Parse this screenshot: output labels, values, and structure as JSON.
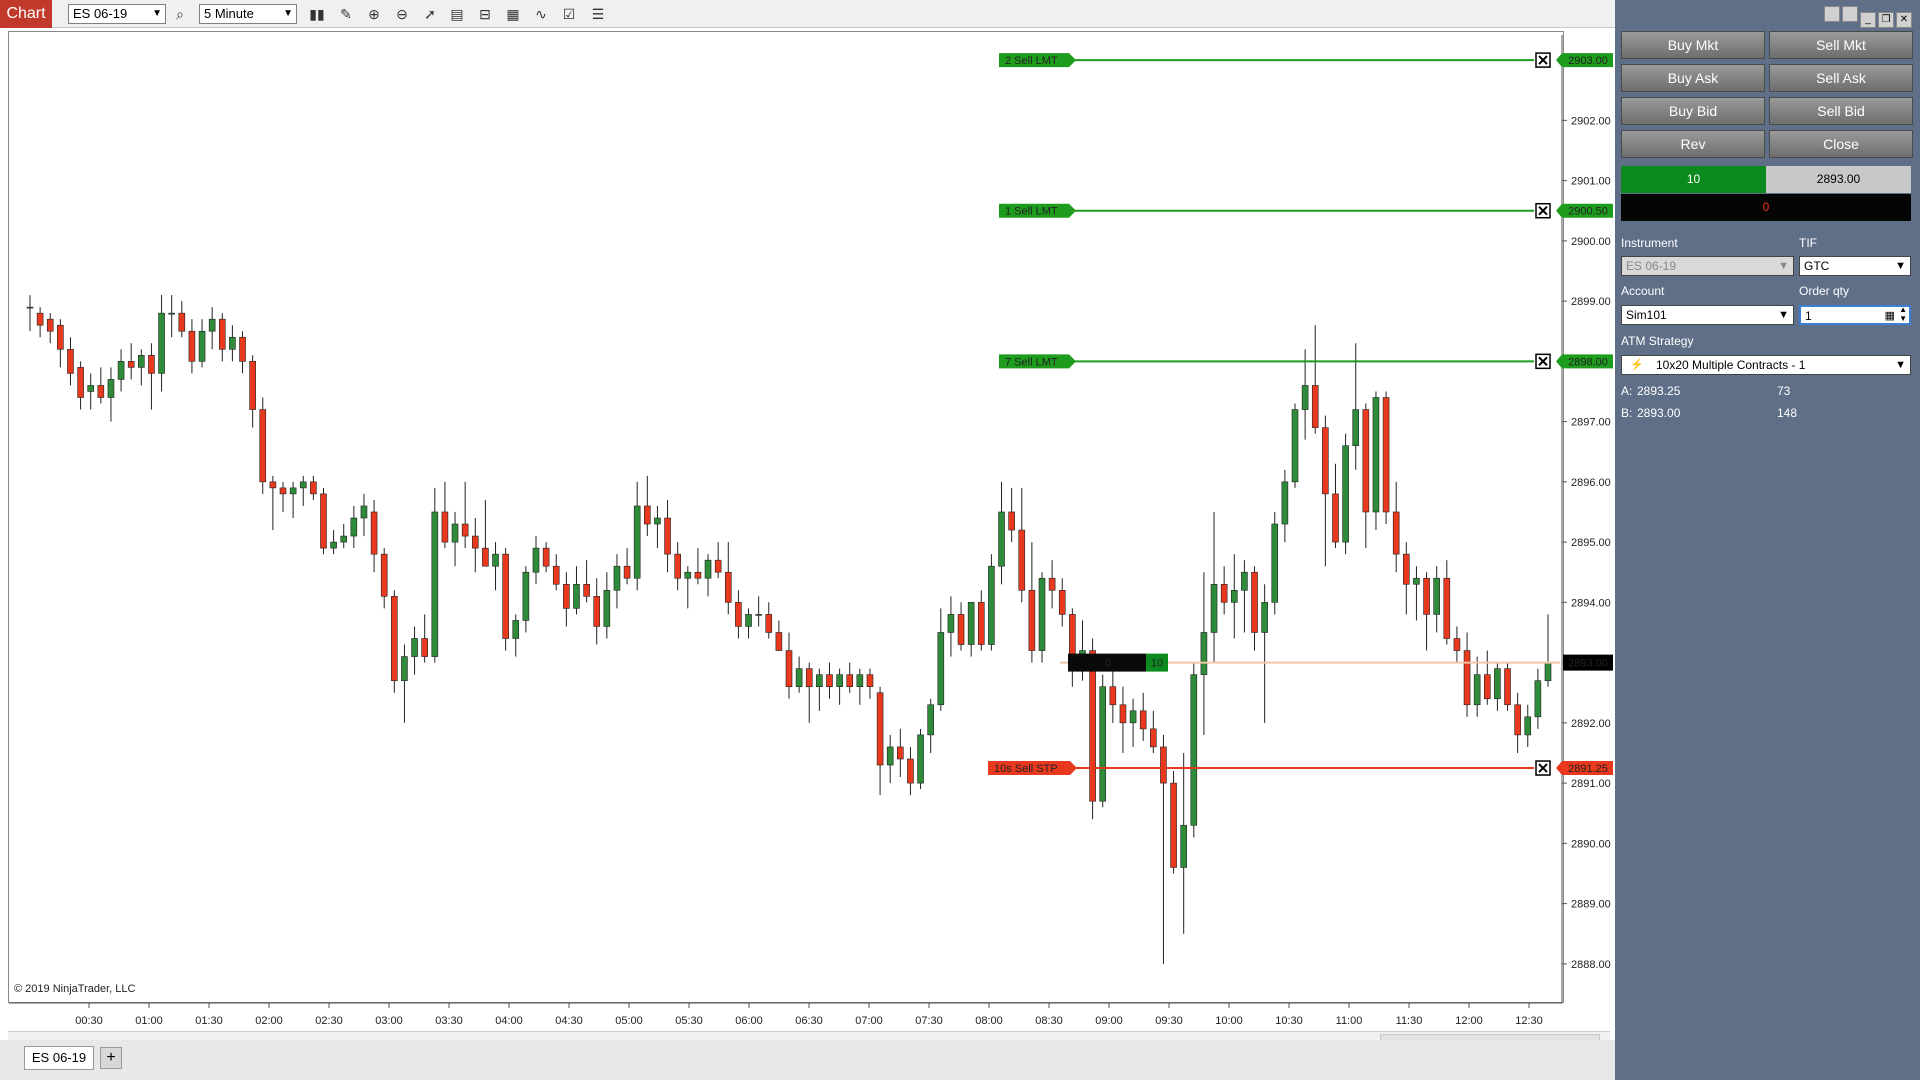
{
  "toolbar": {
    "app_tab": "Chart",
    "instrument": "ES 06-19",
    "interval": "5 Minute"
  },
  "chart": {
    "copyright": "© 2019 NinjaTrader, LLC",
    "price_axis": [
      "2903.00",
      "2902.00",
      "2901.00",
      "2900.00",
      "2899.00",
      "2898.00",
      "2897.00",
      "2896.00",
      "2895.00",
      "2894.00",
      "2893.00",
      "2892.00",
      "2891.00",
      "2890.00",
      "2889.00",
      "2888.00"
    ],
    "time_axis": [
      "00:30",
      "01:00",
      "01:30",
      "02:00",
      "02:30",
      "03:00",
      "03:30",
      "04:00",
      "04:30",
      "05:00",
      "05:30",
      "06:00",
      "06:30",
      "07:00",
      "07:30",
      "08:00",
      "08:30",
      "09:00",
      "09:30",
      "10:00",
      "10:30",
      "11:00",
      "11:30",
      "12:00",
      "12:30"
    ],
    "price_range": [
      2887.4,
      2903.4
    ],
    "last_price": "2893.00",
    "orders": [
      {
        "label": "2  Sell LMT",
        "price": 2903.0,
        "price_text": "2903.00",
        "color": "#1e9c1e"
      },
      {
        "label": "1  Sell LMT",
        "price": 2900.5,
        "price_text": "2900.50",
        "color": "#1e9c1e"
      },
      {
        "label": "7  Sell LMT",
        "price": 2898.0,
        "price_text": "2898.00",
        "color": "#1e9c1e"
      },
      {
        "label": "10s  Sell STP",
        "price": 2891.25,
        "price_text": "2891.25",
        "color": "#e8381e"
      }
    ],
    "position_badge": {
      "pnl": "0",
      "qty": "10"
    },
    "candles": [
      {
        "o": 2898.9,
        "h": 2899.1,
        "l": 2898.5,
        "c": 2898.9
      },
      {
        "o": 2898.8,
        "h": 2898.9,
        "l": 2898.4,
        "c": 2898.6
      },
      {
        "o": 2898.7,
        "h": 2898.8,
        "l": 2898.3,
        "c": 2898.5
      },
      {
        "o": 2898.6,
        "h": 2898.7,
        "l": 2897.9,
        "c": 2898.2
      },
      {
        "o": 2898.2,
        "h": 2898.4,
        "l": 2897.6,
        "c": 2897.8
      },
      {
        "o": 2897.9,
        "h": 2898.0,
        "l": 2897.2,
        "c": 2897.4
      },
      {
        "o": 2897.5,
        "h": 2897.8,
        "l": 2897.2,
        "c": 2897.6
      },
      {
        "o": 2897.6,
        "h": 2897.9,
        "l": 2897.3,
        "c": 2897.4
      },
      {
        "o": 2897.4,
        "h": 2897.9,
        "l": 2897.0,
        "c": 2897.7
      },
      {
        "o": 2897.7,
        "h": 2898.2,
        "l": 2897.5,
        "c": 2898.0
      },
      {
        "o": 2898.0,
        "h": 2898.3,
        "l": 2897.7,
        "c": 2897.9
      },
      {
        "o": 2897.9,
        "h": 2898.2,
        "l": 2897.6,
        "c": 2898.1
      },
      {
        "o": 2898.1,
        "h": 2898.3,
        "l": 2897.2,
        "c": 2897.8
      },
      {
        "o": 2897.8,
        "h": 2899.1,
        "l": 2897.5,
        "c": 2898.8
      },
      {
        "o": 2898.8,
        "h": 2899.1,
        "l": 2898.4,
        "c": 2898.8
      },
      {
        "o": 2898.8,
        "h": 2899.0,
        "l": 2898.4,
        "c": 2898.5
      },
      {
        "o": 2898.5,
        "h": 2898.7,
        "l": 2897.8,
        "c": 2898.0
      },
      {
        "o": 2898.0,
        "h": 2898.7,
        "l": 2897.9,
        "c": 2898.5
      },
      {
        "o": 2898.5,
        "h": 2898.9,
        "l": 2898.2,
        "c": 2898.7
      },
      {
        "o": 2898.7,
        "h": 2898.8,
        "l": 2898.0,
        "c": 2898.2
      },
      {
        "o": 2898.2,
        "h": 2898.6,
        "l": 2898.0,
        "c": 2898.4
      },
      {
        "o": 2898.4,
        "h": 2898.5,
        "l": 2897.8,
        "c": 2898.0
      },
      {
        "o": 2898.0,
        "h": 2898.1,
        "l": 2896.9,
        "c": 2897.2
      },
      {
        "o": 2897.2,
        "h": 2897.4,
        "l": 2895.8,
        "c": 2896.0
      },
      {
        "o": 2896.0,
        "h": 2896.1,
        "l": 2895.2,
        "c": 2895.9
      },
      {
        "o": 2895.9,
        "h": 2896.0,
        "l": 2895.5,
        "c": 2895.8
      },
      {
        "o": 2895.8,
        "h": 2896.0,
        "l": 2895.4,
        "c": 2895.9
      },
      {
        "o": 2895.9,
        "h": 2896.1,
        "l": 2895.6,
        "c": 2896.0
      },
      {
        "o": 2896.0,
        "h": 2896.1,
        "l": 2895.7,
        "c": 2895.8
      },
      {
        "o": 2895.8,
        "h": 2895.9,
        "l": 2894.8,
        "c": 2894.9
      },
      {
        "o": 2894.9,
        "h": 2895.2,
        "l": 2894.8,
        "c": 2895.0
      },
      {
        "o": 2895.0,
        "h": 2895.3,
        "l": 2894.9,
        "c": 2895.1
      },
      {
        "o": 2895.1,
        "h": 2895.6,
        "l": 2894.9,
        "c": 2895.4
      },
      {
        "o": 2895.4,
        "h": 2895.8,
        "l": 2895.1,
        "c": 2895.6
      },
      {
        "o": 2895.5,
        "h": 2895.7,
        "l": 2894.5,
        "c": 2894.8
      },
      {
        "o": 2894.8,
        "h": 2894.9,
        "l": 2893.9,
        "c": 2894.1
      },
      {
        "o": 2894.1,
        "h": 2894.2,
        "l": 2892.5,
        "c": 2892.7
      },
      {
        "o": 2892.7,
        "h": 2893.3,
        "l": 2892.0,
        "c": 2893.1
      },
      {
        "o": 2893.1,
        "h": 2893.6,
        "l": 2892.8,
        "c": 2893.4
      },
      {
        "o": 2893.4,
        "h": 2893.8,
        "l": 2893.0,
        "c": 2893.1
      },
      {
        "o": 2893.1,
        "h": 2895.9,
        "l": 2893.0,
        "c": 2895.5
      },
      {
        "o": 2895.5,
        "h": 2896.0,
        "l": 2894.9,
        "c": 2895.0
      },
      {
        "o": 2895.0,
        "h": 2895.5,
        "l": 2894.6,
        "c": 2895.3
      },
      {
        "o": 2895.3,
        "h": 2896.0,
        "l": 2894.9,
        "c": 2895.1
      },
      {
        "o": 2895.1,
        "h": 2895.4,
        "l": 2894.5,
        "c": 2894.9
      },
      {
        "o": 2894.9,
        "h": 2895.7,
        "l": 2894.7,
        "c": 2894.6
      },
      {
        "o": 2894.6,
        "h": 2895.0,
        "l": 2894.2,
        "c": 2894.8
      },
      {
        "o": 2894.8,
        "h": 2894.9,
        "l": 2893.2,
        "c": 2893.4
      },
      {
        "o": 2893.4,
        "h": 2893.8,
        "l": 2893.1,
        "c": 2893.7
      },
      {
        "o": 2893.7,
        "h": 2894.6,
        "l": 2893.5,
        "c": 2894.5
      },
      {
        "o": 2894.5,
        "h": 2895.1,
        "l": 2894.3,
        "c": 2894.9
      },
      {
        "o": 2894.9,
        "h": 2895.0,
        "l": 2894.5,
        "c": 2894.6
      },
      {
        "o": 2894.6,
        "h": 2894.8,
        "l": 2894.2,
        "c": 2894.3
      },
      {
        "o": 2894.3,
        "h": 2894.5,
        "l": 2893.6,
        "c": 2893.9
      },
      {
        "o": 2893.9,
        "h": 2894.6,
        "l": 2893.8,
        "c": 2894.3
      },
      {
        "o": 2894.3,
        "h": 2894.7,
        "l": 2894.0,
        "c": 2894.1
      },
      {
        "o": 2894.1,
        "h": 2894.4,
        "l": 2893.3,
        "c": 2893.6
      },
      {
        "o": 2893.6,
        "h": 2894.5,
        "l": 2893.4,
        "c": 2894.2
      },
      {
        "o": 2894.2,
        "h": 2894.8,
        "l": 2893.9,
        "c": 2894.6
      },
      {
        "o": 2894.6,
        "h": 2894.9,
        "l": 2894.3,
        "c": 2894.4
      },
      {
        "o": 2894.4,
        "h": 2896.0,
        "l": 2894.2,
        "c": 2895.6
      },
      {
        "o": 2895.6,
        "h": 2896.1,
        "l": 2895.1,
        "c": 2895.3
      },
      {
        "o": 2895.3,
        "h": 2895.6,
        "l": 2894.9,
        "c": 2895.4
      },
      {
        "o": 2895.4,
        "h": 2895.7,
        "l": 2894.5,
        "c": 2894.8
      },
      {
        "o": 2894.8,
        "h": 2895.0,
        "l": 2894.2,
        "c": 2894.4
      },
      {
        "o": 2894.4,
        "h": 2894.6,
        "l": 2893.9,
        "c": 2894.5
      },
      {
        "o": 2894.5,
        "h": 2894.9,
        "l": 2894.3,
        "c": 2894.4
      },
      {
        "o": 2894.4,
        "h": 2894.8,
        "l": 2894.1,
        "c": 2894.7
      },
      {
        "o": 2894.7,
        "h": 2895.0,
        "l": 2894.4,
        "c": 2894.5
      },
      {
        "o": 2894.5,
        "h": 2895.0,
        "l": 2893.8,
        "c": 2894.0
      },
      {
        "o": 2894.0,
        "h": 2894.2,
        "l": 2893.4,
        "c": 2893.6
      },
      {
        "o": 2893.6,
        "h": 2893.9,
        "l": 2893.4,
        "c": 2893.8
      },
      {
        "o": 2893.8,
        "h": 2894.1,
        "l": 2893.6,
        "c": 2893.8
      },
      {
        "o": 2893.8,
        "h": 2894.0,
        "l": 2893.4,
        "c": 2893.5
      },
      {
        "o": 2893.5,
        "h": 2893.7,
        "l": 2893.3,
        "c": 2893.2
      },
      {
        "o": 2893.2,
        "h": 2893.5,
        "l": 2892.4,
        "c": 2892.6
      },
      {
        "o": 2892.6,
        "h": 2893.1,
        "l": 2892.5,
        "c": 2892.9
      },
      {
        "o": 2892.9,
        "h": 2893.0,
        "l": 2892.0,
        "c": 2892.6
      },
      {
        "o": 2892.6,
        "h": 2892.9,
        "l": 2892.2,
        "c": 2892.8
      },
      {
        "o": 2892.8,
        "h": 2893.0,
        "l": 2892.4,
        "c": 2892.6
      },
      {
        "o": 2892.6,
        "h": 2892.9,
        "l": 2892.3,
        "c": 2892.8
      },
      {
        "o": 2892.8,
        "h": 2893.0,
        "l": 2892.5,
        "c": 2892.6
      },
      {
        "o": 2892.6,
        "h": 2892.9,
        "l": 2892.3,
        "c": 2892.8
      },
      {
        "o": 2892.8,
        "h": 2892.9,
        "l": 2892.4,
        "c": 2892.6
      },
      {
        "o": 2892.5,
        "h": 2892.6,
        "l": 2890.8,
        "c": 2891.3
      },
      {
        "o": 2891.3,
        "h": 2891.8,
        "l": 2891.0,
        "c": 2891.6
      },
      {
        "o": 2891.6,
        "h": 2891.9,
        "l": 2891.1,
        "c": 2891.4
      },
      {
        "o": 2891.4,
        "h": 2891.6,
        "l": 2890.8,
        "c": 2891.0
      },
      {
        "o": 2891.0,
        "h": 2891.9,
        "l": 2890.9,
        "c": 2891.8
      },
      {
        "o": 2891.8,
        "h": 2892.4,
        "l": 2891.5,
        "c": 2892.3
      },
      {
        "o": 2892.3,
        "h": 2893.9,
        "l": 2892.2,
        "c": 2893.5
      },
      {
        "o": 2893.5,
        "h": 2894.1,
        "l": 2893.1,
        "c": 2893.8
      },
      {
        "o": 2893.8,
        "h": 2894.0,
        "l": 2893.2,
        "c": 2893.3
      },
      {
        "o": 2893.3,
        "h": 2894.0,
        "l": 2893.1,
        "c": 2894.0
      },
      {
        "o": 2894.0,
        "h": 2894.2,
        "l": 2893.2,
        "c": 2893.3
      },
      {
        "o": 2893.3,
        "h": 2894.8,
        "l": 2893.2,
        "c": 2894.6
      },
      {
        "o": 2894.6,
        "h": 2896.0,
        "l": 2894.3,
        "c": 2895.5
      },
      {
        "o": 2895.5,
        "h": 2895.9,
        "l": 2895.0,
        "c": 2895.2
      },
      {
        "o": 2895.2,
        "h": 2895.9,
        "l": 2894.0,
        "c": 2894.2
      },
      {
        "o": 2894.2,
        "h": 2895.0,
        "l": 2893.0,
        "c": 2893.2
      },
      {
        "o": 2893.2,
        "h": 2894.5,
        "l": 2893.0,
        "c": 2894.4
      },
      {
        "o": 2894.4,
        "h": 2894.7,
        "l": 2893.9,
        "c": 2894.2
      },
      {
        "o": 2894.2,
        "h": 2894.4,
        "l": 2893.6,
        "c": 2893.8
      },
      {
        "o": 2893.8,
        "h": 2893.9,
        "l": 2892.6,
        "c": 2892.9
      },
      {
        "o": 2892.9,
        "h": 2893.7,
        "l": 2892.7,
        "c": 2893.2
      },
      {
        "o": 2893.2,
        "h": 2893.4,
        "l": 2890.4,
        "c": 2890.7
      },
      {
        "o": 2890.7,
        "h": 2892.8,
        "l": 2890.6,
        "c": 2892.6
      },
      {
        "o": 2892.6,
        "h": 2893.0,
        "l": 2892.0,
        "c": 2892.3
      },
      {
        "o": 2892.3,
        "h": 2892.6,
        "l": 2891.5,
        "c": 2892.0
      },
      {
        "o": 2892.0,
        "h": 2892.4,
        "l": 2891.6,
        "c": 2892.2
      },
      {
        "o": 2892.2,
        "h": 2892.5,
        "l": 2891.7,
        "c": 2891.9
      },
      {
        "o": 2891.9,
        "h": 2892.2,
        "l": 2891.5,
        "c": 2891.6
      },
      {
        "o": 2891.6,
        "h": 2891.8,
        "l": 2888.0,
        "c": 2891.0
      },
      {
        "o": 2891.0,
        "h": 2891.2,
        "l": 2889.5,
        "c": 2889.6
      },
      {
        "o": 2889.6,
        "h": 2891.5,
        "l": 2888.5,
        "c": 2890.3
      },
      {
        "o": 2890.3,
        "h": 2893.0,
        "l": 2890.1,
        "c": 2892.8
      },
      {
        "o": 2892.8,
        "h": 2894.5,
        "l": 2891.8,
        "c": 2893.5
      },
      {
        "o": 2893.5,
        "h": 2895.5,
        "l": 2893.0,
        "c": 2894.3
      },
      {
        "o": 2894.3,
        "h": 2894.6,
        "l": 2893.8,
        "c": 2894.0
      },
      {
        "o": 2894.0,
        "h": 2894.8,
        "l": 2893.4,
        "c": 2894.2
      },
      {
        "o": 2894.2,
        "h": 2894.7,
        "l": 2893.5,
        "c": 2894.5
      },
      {
        "o": 2894.5,
        "h": 2894.6,
        "l": 2893.2,
        "c": 2893.5
      },
      {
        "o": 2893.5,
        "h": 2894.3,
        "l": 2892.0,
        "c": 2894.0
      },
      {
        "o": 2894.0,
        "h": 2895.5,
        "l": 2893.8,
        "c": 2895.3
      },
      {
        "o": 2895.3,
        "h": 2896.2,
        "l": 2895.0,
        "c": 2896.0
      },
      {
        "o": 2896.0,
        "h": 2897.3,
        "l": 2895.9,
        "c": 2897.2
      },
      {
        "o": 2897.2,
        "h": 2898.2,
        "l": 2896.7,
        "c": 2897.6
      },
      {
        "o": 2897.6,
        "h": 2898.6,
        "l": 2896.8,
        "c": 2896.9
      },
      {
        "o": 2896.9,
        "h": 2897.1,
        "l": 2894.6,
        "c": 2895.8
      },
      {
        "o": 2895.8,
        "h": 2896.3,
        "l": 2894.9,
        "c": 2895.0
      },
      {
        "o": 2895.0,
        "h": 2896.8,
        "l": 2894.8,
        "c": 2896.6
      },
      {
        "o": 2896.6,
        "h": 2898.3,
        "l": 2896.2,
        "c": 2897.2
      },
      {
        "o": 2897.2,
        "h": 2897.3,
        "l": 2894.9,
        "c": 2895.5
      },
      {
        "o": 2895.5,
        "h": 2897.5,
        "l": 2895.2,
        "c": 2897.4
      },
      {
        "o": 2897.4,
        "h": 2897.5,
        "l": 2895.3,
        "c": 2895.5
      },
      {
        "o": 2895.5,
        "h": 2896.0,
        "l": 2894.5,
        "c": 2894.8
      },
      {
        "o": 2894.8,
        "h": 2895.0,
        "l": 2893.8,
        "c": 2894.3
      },
      {
        "o": 2894.3,
        "h": 2894.6,
        "l": 2893.7,
        "c": 2894.4
      },
      {
        "o": 2894.4,
        "h": 2894.5,
        "l": 2893.2,
        "c": 2893.8
      },
      {
        "o": 2893.8,
        "h": 2894.6,
        "l": 2893.5,
        "c": 2894.4
      },
      {
        "o": 2894.4,
        "h": 2894.7,
        "l": 2893.3,
        "c": 2893.4
      },
      {
        "o": 2893.4,
        "h": 2893.6,
        "l": 2893.0,
        "c": 2893.2
      },
      {
        "o": 2893.2,
        "h": 2893.5,
        "l": 2892.1,
        "c": 2892.3
      },
      {
        "o": 2892.3,
        "h": 2893.1,
        "l": 2892.1,
        "c": 2892.8
      },
      {
        "o": 2892.8,
        "h": 2893.2,
        "l": 2892.3,
        "c": 2892.4
      },
      {
        "o": 2892.4,
        "h": 2893.0,
        "l": 2892.2,
        "c": 2892.9
      },
      {
        "o": 2892.9,
        "h": 2893.0,
        "l": 2892.2,
        "c": 2892.3
      },
      {
        "o": 2892.3,
        "h": 2892.5,
        "l": 2891.5,
        "c": 2891.8
      },
      {
        "o": 2891.8,
        "h": 2892.3,
        "l": 2891.6,
        "c": 2892.1
      },
      {
        "o": 2892.1,
        "h": 2892.9,
        "l": 2891.9,
        "c": 2892.7
      },
      {
        "o": 2892.7,
        "h": 2893.8,
        "l": 2892.6,
        "c": 2893.0
      }
    ]
  },
  "panel": {
    "buttons": {
      "buy_mkt": "Buy Mkt",
      "sell_mkt": "Sell Mkt",
      "buy_ask": "Buy Ask",
      "sell_ask": "Sell Ask",
      "buy_bid": "Buy Bid",
      "sell_bid": "Sell Bid",
      "rev": "Rev",
      "close": "Close"
    },
    "position_qty": "10",
    "position_price": "2893.00",
    "unrealized_pnl": "0",
    "instrument_label": "Instrument",
    "instrument_value": "ES 06-19",
    "tif_label": "TIF",
    "tif_value": "GTC",
    "account_label": "Account",
    "account_value": "Sim101",
    "order_qty_label": "Order qty",
    "order_qty_value": "1",
    "atm_label": "ATM Strategy",
    "atm_value": "10x20 Multiple Contracts - 1",
    "ask_label": "A:",
    "ask_price": "2893.25",
    "ask_size": "73",
    "bid_label": "B:",
    "bid_price": "2893.00",
    "bid_size": "148"
  },
  "bottom": {
    "tab": "ES 06-19",
    "add": "+"
  },
  "colors": {
    "up": "#2e8b3a",
    "down": "#e8381e",
    "limit": "#1e9c1e",
    "stop": "#e8381e",
    "panel": "#5f6f88",
    "last_price_line": "#f2c8a8"
  }
}
